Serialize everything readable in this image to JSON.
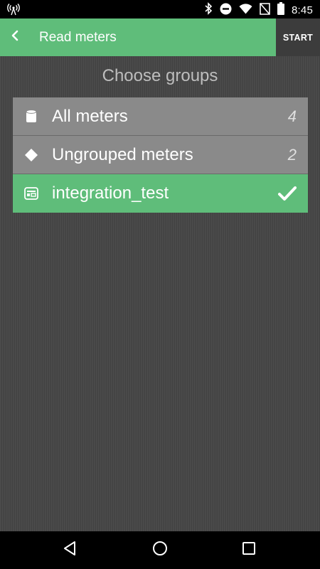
{
  "status": {
    "time": "8:45",
    "icons": [
      "wireless-broadcast-icon",
      "bluetooth-icon",
      "do-not-disturb-icon",
      "wifi-icon",
      "no-sim-icon",
      "battery-icon"
    ]
  },
  "toolbar": {
    "back_icon": "chevron-left-icon",
    "title": "Read meters",
    "start_label": "START"
  },
  "main": {
    "heading": "Choose groups",
    "groups": [
      {
        "label": "All meters",
        "count": "4",
        "icon": "database-icon",
        "selected": false
      },
      {
        "label": "Ungrouped meters",
        "count": "2",
        "icon": "diamond-icon",
        "selected": false
      },
      {
        "label": "integration_test",
        "count": "",
        "icon": "group-card-icon",
        "selected": true
      }
    ]
  },
  "navigation": {
    "buttons": [
      "back-triangle-icon",
      "home-circle-icon",
      "recents-square-icon"
    ]
  },
  "colors": {
    "accent": "#5fbd7a",
    "background": "#474747",
    "item": "#8a8a8a"
  }
}
